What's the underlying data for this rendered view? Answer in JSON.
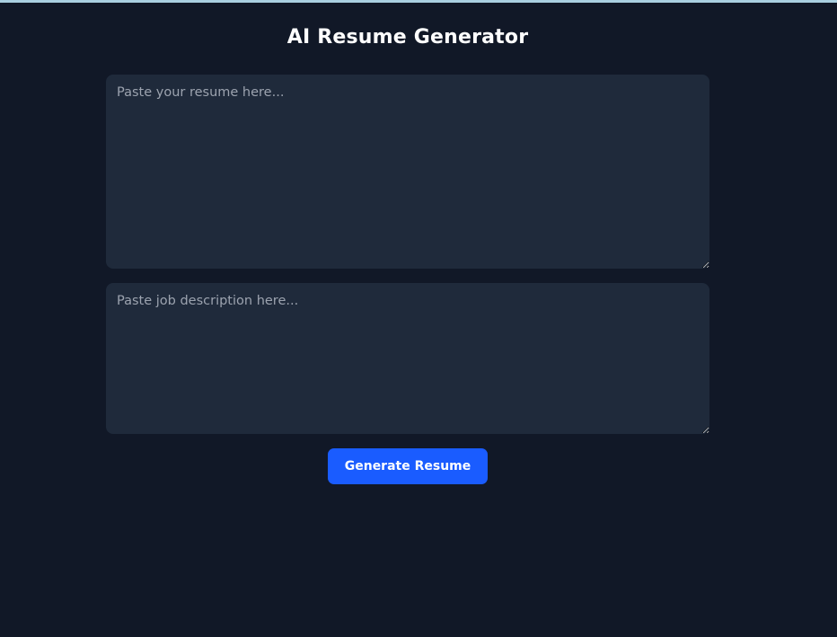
{
  "header": {
    "title": "AI Resume Generator"
  },
  "form": {
    "resume_placeholder": "Paste your resume here...",
    "job_placeholder": "Paste job description here...",
    "generate_label": "Generate Resume"
  },
  "colors": {
    "background": "#111827",
    "field_background": "#1f2a3b",
    "accent": "#1a5cff",
    "top_border": "#a9cfe0"
  }
}
